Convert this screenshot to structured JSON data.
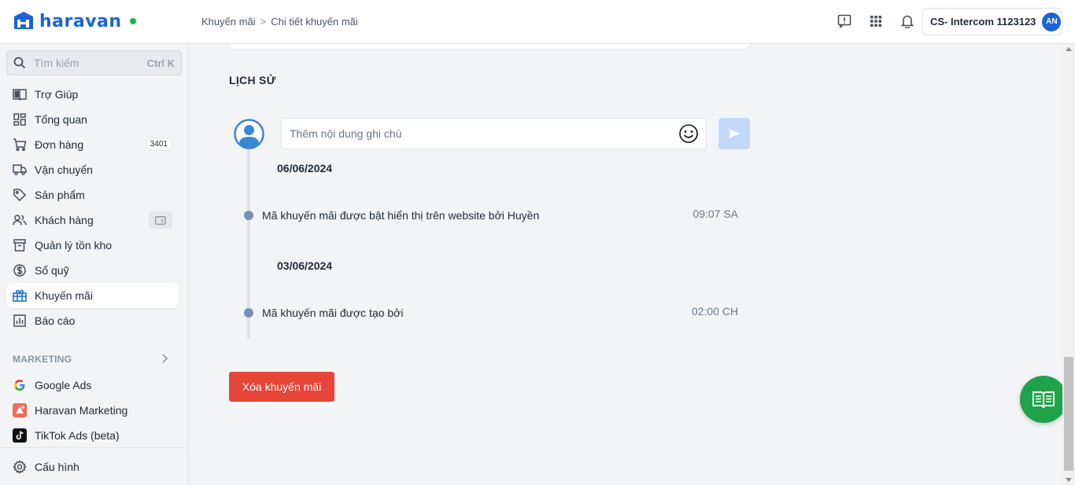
{
  "app": {
    "logo_text": "haravan"
  },
  "breadcrumb": {
    "parent": "Khuyến mãi",
    "separator": ">",
    "current": "Chi tiết khuyến mãi"
  },
  "account": {
    "name": "CS- Intercom 1123123",
    "initials": "AN"
  },
  "search": {
    "placeholder": "Tìm kiếm",
    "shortcut": "Ctrl K"
  },
  "nav": {
    "help": "Trợ Giúp",
    "overview": "Tổng quan",
    "orders": "Đơn hàng",
    "orders_badge": "3401",
    "shipping": "Vận chuyển",
    "products": "Sản phẩm",
    "customers": "Khách hàng",
    "inventory": "Quản lý tồn kho",
    "cashbook": "Sổ quỹ",
    "promotions": "Khuyến mãi",
    "reports": "Báo cáo"
  },
  "marketing": {
    "label": "MARKETING",
    "google_ads": "Google Ads",
    "haravan_marketing": "Haravan Marketing",
    "tiktok_ads": "TikTok Ads (beta)"
  },
  "settings": {
    "label": "Cấu hình"
  },
  "history": {
    "title": "LỊCH SỬ",
    "note_placeholder": "Thêm nội dung ghi chú",
    "groups": [
      {
        "date": "06/06/2024",
        "event": "Mã khuyến mãi được bật hiển thị trên website bởi Huyền",
        "time": "09:07 SA"
      },
      {
        "date": "03/06/2024",
        "event": "Mã khuyến mãi được tạo bởi",
        "time": "02:00 CH"
      }
    ]
  },
  "actions": {
    "delete_label": "Xóa khuyến mãi"
  },
  "colors": {
    "brand": "#1a64d6",
    "danger": "#e7453a",
    "help_fab": "#1fa34a"
  }
}
